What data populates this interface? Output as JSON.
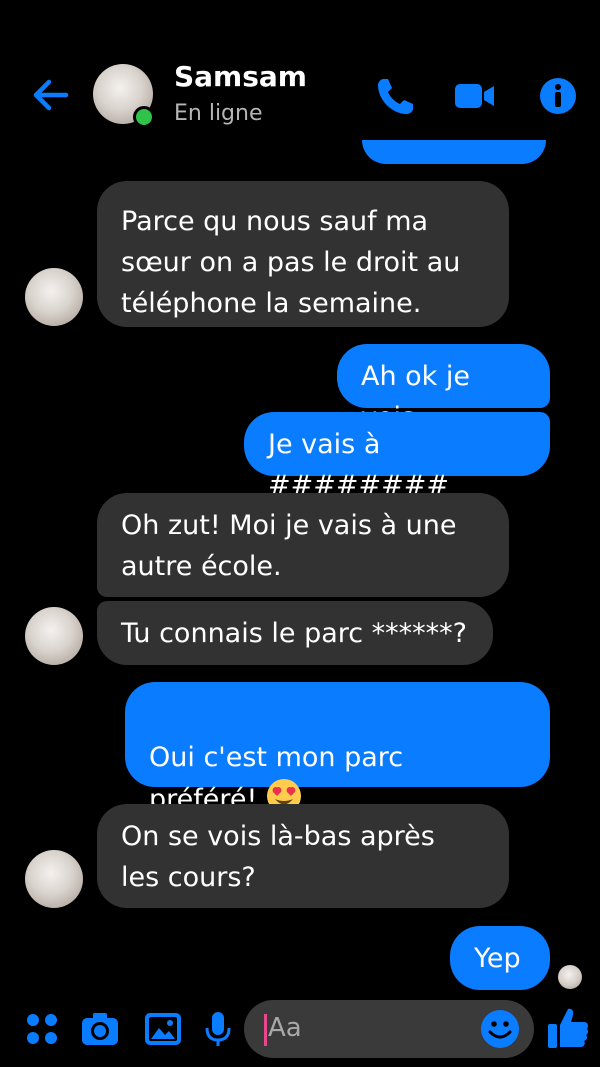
{
  "header": {
    "contact_name": "Samsam",
    "status": "En ligne",
    "accent_color": "#0a7cff",
    "online_color": "#31c24a"
  },
  "messages": [
    {
      "from": "contact",
      "text": "Parce qu nous sauf ma\nsœur on a pas le droit au\ntéléphone la semaine."
    },
    {
      "from": "me",
      "text": "Ah ok je vois"
    },
    {
      "from": "me",
      "text": "Je vais à ########"
    },
    {
      "from": "contact",
      "text": "Oh zut! Moi je vais à une\nautre école."
    },
    {
      "from": "contact",
      "text": "Tu connais le parc ******?"
    },
    {
      "from": "me",
      "text": "Oui c'est mon parc\npréféré! ",
      "emoji": "heart-eyes"
    },
    {
      "from": "contact",
      "text": "On se vois là-bas après\nles cours?"
    },
    {
      "from": "me",
      "text": "Yep"
    }
  ],
  "composer": {
    "placeholder": "Aa",
    "icons": [
      "apps-icon",
      "camera-icon",
      "gallery-icon",
      "microphone-icon",
      "emoji-icon",
      "thumbs-up-icon"
    ]
  }
}
